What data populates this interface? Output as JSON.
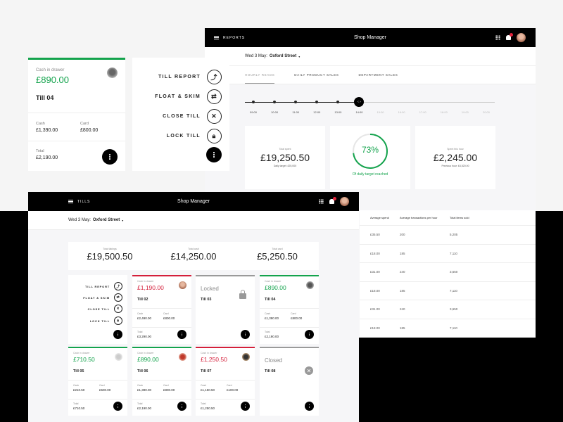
{
  "reports": {
    "menu_label": "REPORTS",
    "title": "Shop Manager",
    "date": "Wed 3 May:",
    "store": "Oxford Street",
    "tabs": [
      "HOURLY READS",
      "DAILY PRODUCT SALES",
      "DEPARTMENT SALES"
    ],
    "timeline": [
      "09:00",
      "10:00",
      "11:00",
      "12:00",
      "13:00",
      "14:00",
      "15:00",
      "16:00",
      "17:00",
      "18:00",
      "19:00",
      "20:00"
    ],
    "timeline_active_index": 5,
    "knob_label": "‹ ›",
    "stats": {
      "total_spent_label": "Total spent",
      "total_spent": "£19,250.50",
      "daily_target": "Daily target: £25,000",
      "target_pct": "73%",
      "target_fraction": 0.73,
      "target_text": "Of daily target reached",
      "spent_hour_label": "Spent this hour",
      "spent_hour": "£2,245.00",
      "previous_hour": "Previous hour: £4,520.00"
    },
    "table": {
      "headers": [
        "Average spend",
        "Average transactions per hour",
        "Total items sold"
      ],
      "rows": [
        [
          "£35.50",
          "200",
          "5,205"
        ],
        [
          "£18.00",
          "185",
          "7,110"
        ],
        [
          "£31.00",
          "240",
          "3,650"
        ],
        [
          "£18.00",
          "185",
          "7,110"
        ],
        [
          "£31.00",
          "240",
          "3,650"
        ],
        [
          "£18.00",
          "185",
          "7,110"
        ]
      ]
    }
  },
  "till_detail": {
    "label": "Cash in drawer",
    "amount": "£890.00",
    "name": "Till 04",
    "cash_label": "Cash",
    "cash": "£1,390.00",
    "card_label": "Card",
    "card": "£800.00",
    "total_label": "Total",
    "total": "£2,190.00"
  },
  "till_menu": {
    "till_report": "TILL REPORT",
    "float_skim": "FLOAT & SKIM",
    "close_till": "CLOSE TILL",
    "lock_till": "LOCK TILL"
  },
  "tills": {
    "menu_label": "TILLS",
    "title": "Shop Manager",
    "date": "Wed 3 May:",
    "store": "Oxford Street",
    "summary": [
      {
        "label": "Total takings",
        "value": "£19,500.50"
      },
      {
        "label": "Total cash",
        "value": "£14,250.00"
      },
      {
        "label": "Total card",
        "value": "£5,250.50"
      }
    ],
    "cash_in_drawer_label": "Cash in drawer",
    "cash_label": "Cash",
    "card_label": "Card",
    "total_label": "Total",
    "locked_label": "Locked",
    "closed_label": "Closed",
    "cards": [
      {
        "amount": "£1,190.00",
        "name": "Till 02",
        "cash": "£2,490.00",
        "card": "£800.00",
        "total": "£3,290.00"
      },
      {
        "name": "Till 03"
      },
      {
        "amount": "£890.00",
        "name": "Till 04",
        "cash": "£1,390.00",
        "card": "£800.00",
        "total": "£2,190.00"
      },
      {
        "amount": "£710.50",
        "name": "Till 05",
        "cash": "£210.50",
        "card": "£500.00",
        "total": "£710.50"
      },
      {
        "amount": "£890.00",
        "name": "Till 06",
        "cash": "£1,390.00",
        "card": "£800.00",
        "total": "£2,190.00"
      },
      {
        "amount": "£1,250.50",
        "name": "Till 07",
        "cash": "£1,150.50",
        "card": "£100.00",
        "total": "£1,250.50"
      },
      {
        "name": "Till 08"
      }
    ]
  },
  "colors": {
    "green": "#13a34c",
    "red": "#d41f3a",
    "grey": "#9a9a9a"
  },
  "icons": [
    "hamburger-icon",
    "apps-grid-icon",
    "bell-icon",
    "trend-icon",
    "swap-icon",
    "close-circle-icon",
    "lock-icon",
    "more-vertical-icon"
  ]
}
